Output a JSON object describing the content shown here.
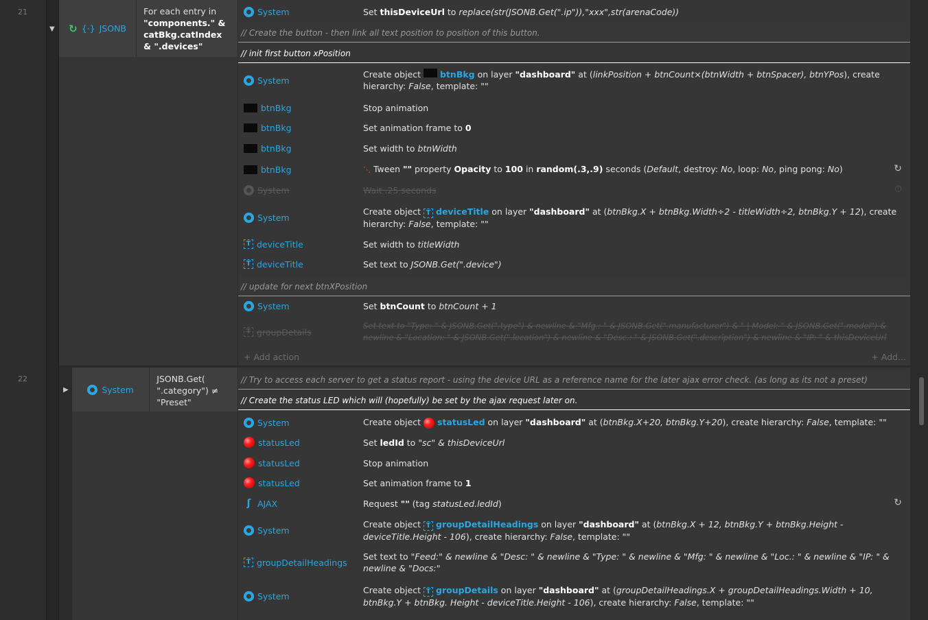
{
  "events": [
    {
      "line_number": "21",
      "condition": {
        "object": "JSONB",
        "icon": "loop-icon",
        "text_prefix": "For each entry in",
        "text_strong": "\"components.\" & catBkg.catIndex & \".devices\""
      },
      "actions_top": {
        "object": "System",
        "pre": "Set ",
        "strong": "thisDeviceUrl",
        "post": " to ",
        "italic": "replace(str(JSONB.Get(\".ip\")),\"xxx\",str(arenaCode))"
      },
      "comment1": "//  Create the button - then link all text position to position of this button.",
      "comment2": "//  init first button xPosition",
      "act_create_btn": {
        "object": "System",
        "pre": "Create object ",
        "name": "btnBkg",
        "mid": " on layer ",
        "layer": "\"dashboard\"",
        "at": " at (",
        "expr": "linkPosition + btnCount×(btnWidth + btnSpacer), btnYPos",
        "tail": "), create hierarchy: ",
        "hier": "False",
        "template": ", template: \"\""
      },
      "act_stop": {
        "object": "btnBkg",
        "text": "Stop animation"
      },
      "act_frame": {
        "object": "btnBkg",
        "text": "Set animation frame to ",
        "value": "0"
      },
      "act_width": {
        "object": "btnBkg",
        "text": "Set width to ",
        "value": "btnWidth"
      },
      "act_tween": {
        "object": "btnBkg",
        "t1": " Tween ",
        "t2": "\"\"",
        "t3": " property ",
        "t4": "Opacity",
        "t5": " to ",
        "t6": "100",
        "t7": " in ",
        "t8": "random(.3,.9)",
        "t9": " seconds (",
        "t10": "Default",
        "t11": ", destroy: ",
        "t12": "No",
        "t13": ", loop: ",
        "t14": "No",
        "t15": ", ping pong: ",
        "t16": "No",
        "t17": ")"
      },
      "act_wait": {
        "object": "System",
        "text": "Wait .25 seconds"
      },
      "act_create_title": {
        "object": "System",
        "pre": "Create object ",
        "name": "deviceTitle",
        "mid": " on layer ",
        "layer": "\"dashboard\"",
        "at": " at (",
        "expr": "btnBkg.X + btnBkg.Width÷2 - titleWidth÷2, btnBkg.Y + 12",
        "tail": "), create hierarchy: ",
        "hier": "False",
        "template": ", template: \"\""
      },
      "act_title_width": {
        "object": "deviceTitle",
        "text": "Set width to ",
        "value": "titleWidth"
      },
      "act_title_text": {
        "object": "deviceTitle",
        "text": "Set text to ",
        "value": "JSONB.Get(\".device\")"
      },
      "comment3": "//  update for next btnXPosition",
      "act_count": {
        "object": "System",
        "pre": "Set ",
        "strong": "btnCount",
        "post": " to ",
        "italic": "btnCount + 1"
      },
      "act_group_details": {
        "object": "groupDetails",
        "text": "Set text to \"Type: \" & JSONB.Get(\".type\") & newline & \"Mfg.: \" & JSONB.Get(\".manufacturer\") & \" | Model: \" & JSONB.Get(\".model\") & newline & \"Location: \" & JSONB.Get(\".location\") & newline & \"Desc.: \" & JSONB.Get(\".description\") & newline & \"IP: \" & thisDeviceUrl"
      },
      "add_action": "+ Add action",
      "add_more": "+ Add..."
    },
    {
      "line_number": "22",
      "condition": {
        "object": "System",
        "text": "JSONB.Get( \".category\") ≠ \"Preset\""
      },
      "comment1": "//  Try to access each server to get a status report - using the device URL as a reference name for the later ajax error check. (as long as its not a preset)",
      "comment2": "//  Create the status LED which will (hopefully) be set by the ajax request later on.",
      "act_create_led": {
        "object": "System",
        "pre": "Create object ",
        "name": "statusLed",
        "mid": " on layer ",
        "layer": "\"dashboard\"",
        "at": " at (",
        "expr": "btnBkg.X+20, btnBkg.Y+20",
        "tail": "), create hierarchy: ",
        "hier": "False",
        "template": ", template: \"\""
      },
      "act_led_id": {
        "object": "statusLed",
        "pre": "Set ",
        "strong": "ledId",
        "post": " to ",
        "italic": "\"sc\" & thisDeviceUrl"
      },
      "act_led_stop": {
        "object": "statusLed",
        "text": "Stop animation"
      },
      "act_led_frame": {
        "object": "statusLed",
        "text": "Set animation frame to ",
        "value": "1"
      },
      "act_ajax": {
        "object": "AJAX",
        "pre": "Request ",
        "strong": "\"\"",
        "post": " (tag ",
        "italic": "statusLed.ledId",
        "end": ")"
      },
      "act_create_headings": {
        "object": "System",
        "pre": "Create object ",
        "name": "groupDetailHeadings",
        "mid": " on layer ",
        "layer": "\"dashboard\"",
        "at": " at (",
        "expr": "btnBkg.X + 12, btnBkg.Y + btnBkg.Height - deviceTitle.Height - 106",
        "tail": "), create hierarchy: ",
        "hier": "False",
        "template": ", template: \"\""
      },
      "act_headings_text": {
        "object": "groupDetailHeadings",
        "text": "Set text to ",
        "value": "\"Feed:\" & newline & \"Desc: \" & newline & \"Type: \" & newline & \"Mfg: \" & newline & \"Loc.: \" & newline & \"IP: \" & newline & \"Docs:\""
      },
      "act_create_details": {
        "object": "System",
        "pre": "Create object ",
        "name": "groupDetails",
        "mid": " on layer ",
        "layer": "\"dashboard\"",
        "at": " at (",
        "expr": "groupDetailHeadings.X + groupDetailHeadings.Width + 10, btnBkg.Y + btnBkg. Height - deviceTitle.Height - 106",
        "tail": "), create hierarchy: ",
        "hier": "False",
        "template": ", template: \"\""
      }
    }
  ],
  "colors": {
    "accent": "#2aa6e0",
    "background": "#2b2b2b",
    "block": "#353535"
  }
}
